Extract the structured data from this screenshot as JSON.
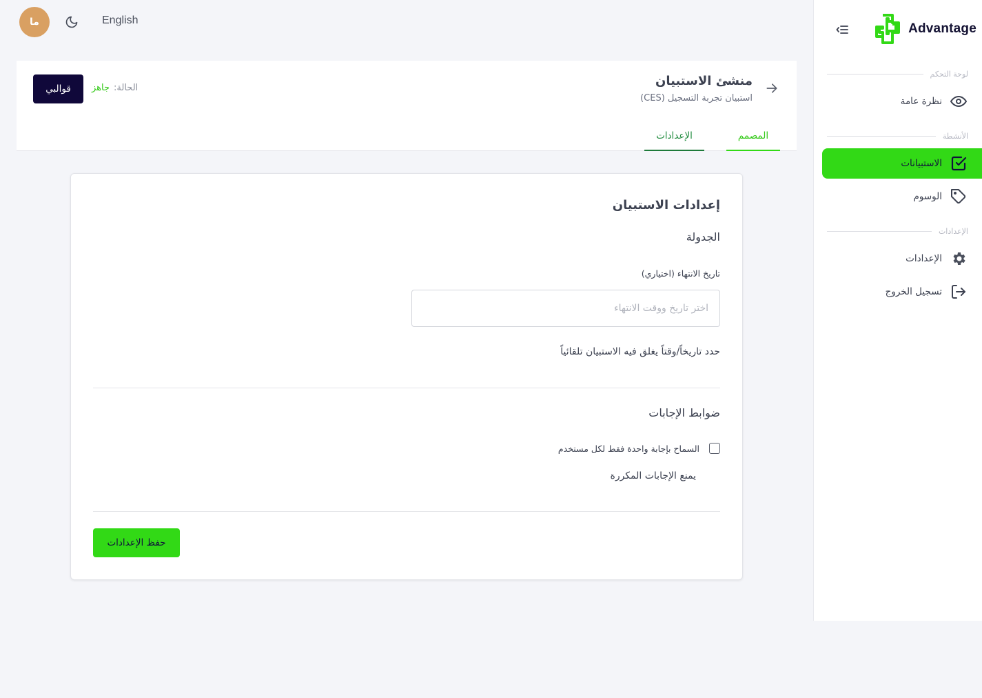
{
  "topbar": {
    "avatar_initials": "ما",
    "theme_icon": "moon-icon",
    "language": "English"
  },
  "sidebar": {
    "brand": "Advantage",
    "brand_color": "#32d916",
    "sections": {
      "dashboard": "لوحة التحكم",
      "activities": "الأنشطة",
      "settings": "الإعدادات"
    },
    "items": [
      {
        "label": "نظرة عامة",
        "icon": "eye-icon"
      },
      {
        "label": "الاستبيانات",
        "icon": "checkbox-icon",
        "active": true
      },
      {
        "label": "الوسوم",
        "icon": "tag-icon"
      },
      {
        "label": "الإعدادات",
        "icon": "gear-icon"
      },
      {
        "label": "تسجيل الخروج",
        "icon": "logout-icon"
      }
    ]
  },
  "header": {
    "title": "منشئ الاستبيان",
    "subtitle": "استبيان تجربة التسجيل (CES)",
    "status_label": "الحالة:",
    "status_value": "جاهز",
    "templates_button": "قوالبي",
    "tabs": [
      {
        "label": "المصمم",
        "active": true
      },
      {
        "label": "الإعدادات",
        "active": false
      }
    ]
  },
  "card": {
    "title": "إعدادات الاستبيان",
    "schedule_title": "الجدولة",
    "end_date_label": "تاريخ الانتهاء (اختياري)",
    "end_date_placeholder": "اختر تاريخ ووقت الانتهاء",
    "end_date_value": "",
    "end_date_help": "حدد تاريخاً/وقتاً يغلق فيه الاستبيان تلقائياً",
    "controls_title": "ضوابط الإجابات",
    "single_response_label": "السماح بإجابة واحدة فقط لكل مستخدم",
    "single_response_checked": false,
    "single_response_help": "يمنع الإجابات المكررة",
    "save_button": "حفظ الإعدادات"
  }
}
